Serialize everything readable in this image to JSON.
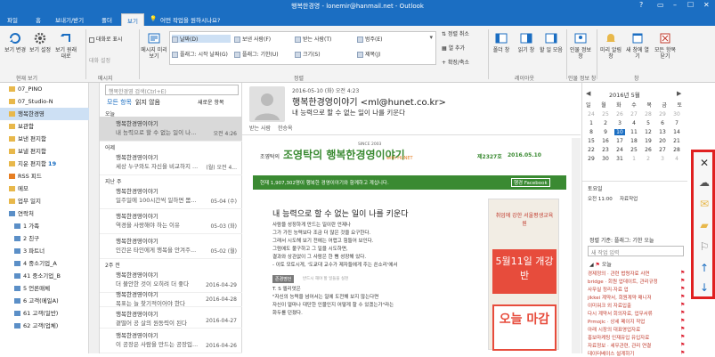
{
  "window": {
    "title": "행복한경영 - lonemir@hanmail.net - Outlook",
    "controls": [
      "?",
      "▭",
      "–",
      "☐",
      "✕"
    ]
  },
  "ribbon_tabs": [
    "파일",
    "홈",
    "보내기/받기",
    "폴더",
    "보기"
  ],
  "tell_me": "어떤 작업을 원하시나요?",
  "ribbon": {
    "view_change": "보기 변경",
    "view_settings": "보기 설정",
    "view_reset": "보기 원래대로",
    "show_conversations": "대화로 표시",
    "conversation_settings": "대화 설정",
    "message_preview": "메시지 미리 보기",
    "sort_options": [
      "날짜(D)",
      "보낸 사람(F)",
      "받는 사람(T)",
      "범주(E)",
      "플래그: 시작 날짜(G)",
      "플래그: 기한(U)",
      "크기(S)",
      "제목(J)"
    ],
    "reverse_sort": "정렬 취소",
    "add_columns": "열 추가",
    "expand_collapse": "확장/축소",
    "folder_pane": "폴더 창",
    "reading_pane": "읽기 창",
    "todo_bar": "할 일 모음",
    "people_pane": "인물 정보 창",
    "reminders": "미리 알림 창",
    "new_window": "새 창에 열기",
    "close_all": "모든 항목 닫기",
    "group_labels": [
      "현재 보기",
      "메시지",
      "정렬",
      "레이아웃",
      "인물 정보 창",
      "창"
    ]
  },
  "folders": [
    {
      "name": "07_PINO",
      "count": ""
    },
    {
      "name": "07_Studio-N",
      "count": ""
    },
    {
      "name": "행복한경영",
      "count": ""
    },
    {
      "name": "보관함",
      "count": ""
    },
    {
      "name": "보낸 편지함",
      "count": ""
    },
    {
      "name": "보낼 편지함",
      "count": ""
    },
    {
      "name": "지운 편지함",
      "count": "19"
    },
    {
      "name": "RSS 피드",
      "count": ""
    },
    {
      "name": "메모",
      "count": ""
    },
    {
      "name": "업무 일지",
      "count": ""
    },
    {
      "name": "연락처",
      "count": ""
    },
    {
      "name": "1 가족",
      "count": ""
    },
    {
      "name": "2 친구",
      "count": ""
    },
    {
      "name": "3 파트너",
      "count": ""
    },
    {
      "name": "4 중소기업_A",
      "count": ""
    },
    {
      "name": "41 중소기업_B",
      "count": ""
    },
    {
      "name": "5 언론매체",
      "count": ""
    },
    {
      "name": "6 고객(메일A)",
      "count": ""
    },
    {
      "name": "61 고객(일반)",
      "count": ""
    },
    {
      "name": "62 고객(업체)",
      "count": ""
    }
  ],
  "message_list": {
    "search_placeholder": "행복한경영 검색(Ctrl+E)",
    "filters": [
      "모든 항목",
      "읽지 않음"
    ],
    "sort_by": "새로운 항목",
    "groups": [
      "오늘",
      "어제",
      "지난 주",
      "2주 전"
    ],
    "messages": [
      {
        "sender": "행복한경영이야기",
        "preview": "내 능력으로 할 수 없는 일이 나...",
        "date": "오전 4:26"
      },
      {
        "sender": "행복한경영이야기",
        "preview": "세상 누구와도 자신을 비교하지 ...",
        "date": "(월) 오전 4..."
      },
      {
        "sender": "행복한경영이야기",
        "preview": "일주일에 100시간씩 일하면 몸...",
        "date": "05-04 (수)"
      },
      {
        "sender": "행복한경영이야기",
        "preview": "역경을 사랑해야 하는 이유",
        "date": "05-03 (화)"
      },
      {
        "sender": "행복한경영이야기",
        "preview": "인간은 타인에게 행복을 안겨주...",
        "date": "05-02 (월)"
      },
      {
        "sender": "행복한경영이야기",
        "preview": "더 불안한 것이 오히려 더 좋다",
        "date": "2016-04-29"
      },
      {
        "sender": "행복한경영이야기",
        "preview": "목표는 늘 찾기적이어야 한다",
        "date": "2016-04-28"
      },
      {
        "sender": "행복한경영이야기",
        "preview": "곁떨어 공 살의 원동력이 된다",
        "date": "2016-04-27"
      },
      {
        "sender": "행복한경영이야기",
        "preview": "이 공장은 사람을 만드는 공장입...",
        "date": "2016-04-26"
      }
    ]
  },
  "reading": {
    "datetime": "2016-05-10 (화) 오전 4:23",
    "from": "행복한경영이야기 <ml@hunet.co.kr>",
    "subject": "내 능력으로 할 수 없는 일이 나를 키운다",
    "to_label": "받는 사람",
    "to": "한승옥",
    "newsletter_name": "조영탁의 행복한경영이야기",
    "since": "SINCE 2003",
    "with": "with HUNET",
    "issue": "제2327호",
    "issue_date": "2016.05.10",
    "banner": "현재 1,907,302명이 행복한 경영이야기와 함께하고 계십니다.",
    "facebook": "행경 Facebook",
    "article_title": "내 능력으로 할 수 없는 일이 나를 키운다",
    "article_lines": [
      "사람을 성장하게 만드는 일이란 언제나",
      "그가 가진 능력보다 조금 더 많은 것을 요구한다.",
      "그래서 시도해 보기 전에는 어렵고 힘들어 보인다.",
      "그럼에도 불구하고 그 일을 시도하면,",
      "결과와 상관없이 그 사람은 한 뼘 성장해 있다.",
      "- 이토 모토시게, '도쿄대 교수가 제자들에게 주는 쓴소리'에서"
    ],
    "label": "존경명언",
    "label_sub": "반드시 해야 할 일들을 실천",
    "quote_lines": [
      "T. S 엘리엇은",
      "\"자신의 능력을 넘어서는 일에 도전해 보지 않는다면",
      "자신이 얼마나 대단한 인물인지 어떻게 할 수 있겠는가\"라는",
      "화두를 던졌다."
    ],
    "ad": {
      "top": "취업에 강한 서울평생교육원",
      "date": "5월11일 개강반",
      "today": "오늘 마감"
    }
  },
  "calendar": {
    "month": "2016년 5월",
    "weekdays": [
      "일",
      "월",
      "화",
      "수",
      "목",
      "금",
      "토"
    ],
    "weeks": [
      [
        "24",
        "25",
        "26",
        "27",
        "28",
        "29",
        "30"
      ],
      [
        "1",
        "2",
        "3",
        "4",
        "5",
        "6",
        "7"
      ],
      [
        "8",
        "9",
        "10",
        "11",
        "12",
        "13",
        "14"
      ],
      [
        "15",
        "16",
        "17",
        "18",
        "19",
        "20",
        "21"
      ],
      [
        "22",
        "23",
        "24",
        "25",
        "26",
        "27",
        "28"
      ],
      [
        "29",
        "30",
        "31",
        "1",
        "2",
        "3",
        "4"
      ]
    ],
    "today": "10",
    "today_label": "토요일",
    "event_time": "오전 11:00",
    "event": "자료작업"
  },
  "tasks": {
    "header": "정렬 기준: 플래그: 기한 오늘",
    "input_placeholder": "새 작업 입력",
    "group": "오늘",
    "items": [
      "경제정의 · 관련 법령자료 사연",
      "bridge · 회원 업데이트, 관리규정",
      "사무실 정리·자료 업",
      "jikkei 계약서, 회원계약 매니저",
      "이미워크 외 자료입출",
      "다시 계약서 회의자료, 업무서류",
      "Prmojic · 상세 페이지 작업",
      "아래 시장의 대표영업자료",
      "홍보마케팅 인재유입 유입자료",
      "자료정보 · 세무관련, 관리 연결",
      "데이터베이스 설계하기"
    ]
  },
  "side_strip": [
    "close-icon",
    "cloud-icon",
    "envelope-icon",
    "folder-icon",
    "flag-icon",
    "arrow-up-icon",
    "arrow-down-icon"
  ],
  "colors": {
    "accent": "#1b6ec2",
    "newsletter_green": "#3a8a32",
    "highlight_red": "#e02020"
  }
}
